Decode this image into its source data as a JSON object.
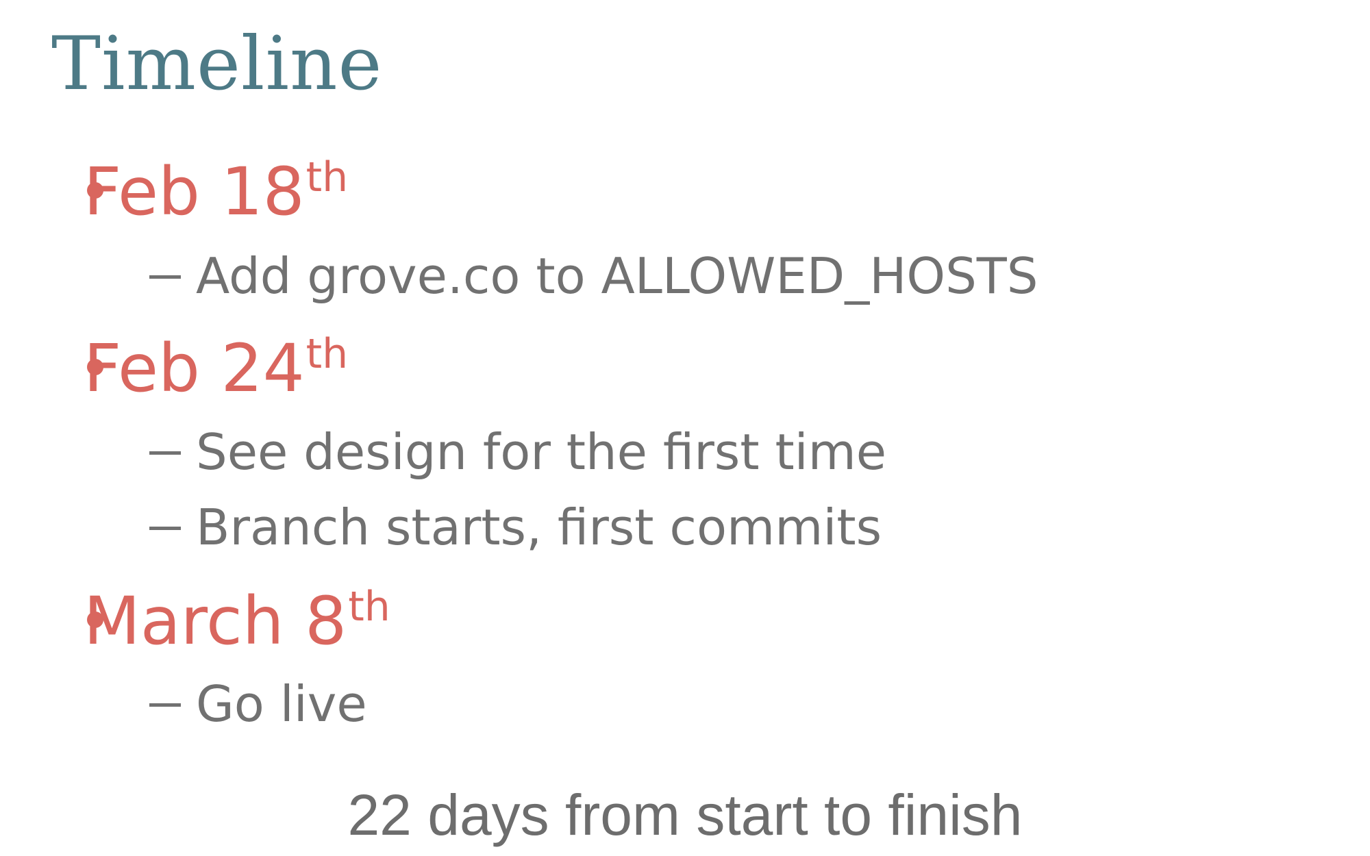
{
  "slide": {
    "title": "Timeline",
    "entries": [
      {
        "date": "Feb 18",
        "ordinal": "th",
        "notes": [
          "Add grove.co to ALLOWED_HOSTS"
        ]
      },
      {
        "date": "Feb 24",
        "ordinal": "th",
        "notes": [
          "See design for the first time",
          "Branch starts, first commits"
        ]
      },
      {
        "date": "March 8",
        "ordinal": "th",
        "notes": [
          "Go live"
        ]
      }
    ],
    "footer": "22 days from start to finish"
  },
  "colors": {
    "title": "#4d7a86",
    "accent": "#d9665e",
    "body_text": "#717171",
    "background": "#ffffff"
  },
  "icons": {
    "bullet": "filled-circle",
    "sub_bullet": "en-dash"
  }
}
